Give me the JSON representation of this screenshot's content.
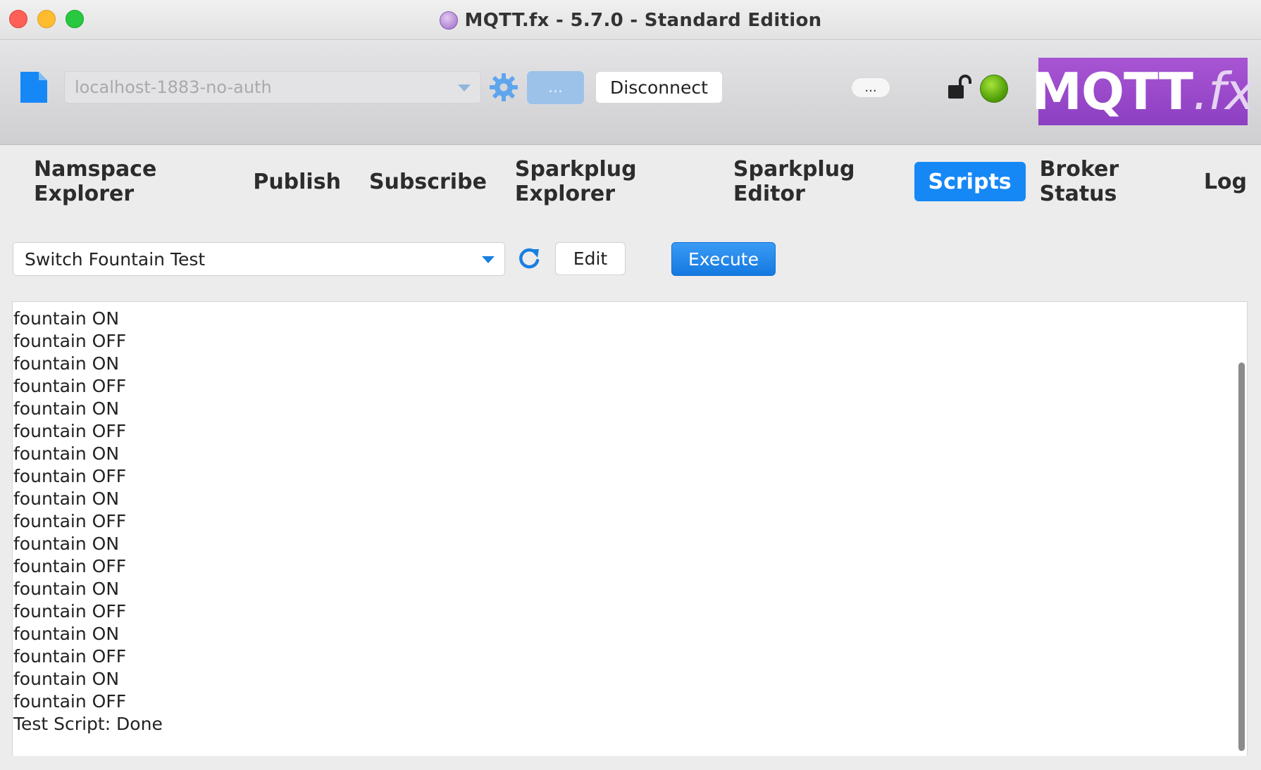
{
  "window": {
    "title": "MQTT.fx - 5.7.0 - Standard Edition"
  },
  "toolbar": {
    "connection_profile": "localhost-1883-no-auth",
    "options_label": "...",
    "disconnect_label": "Disconnect",
    "more_label": "...",
    "status_color": "#5aa80e"
  },
  "logo": {
    "text_main": "MQTT",
    "text_dot": ".",
    "text_fx": "fx",
    "background": "#9b4fcf"
  },
  "tabs": [
    {
      "label": "Namspace Explorer",
      "active": false
    },
    {
      "label": "Publish",
      "active": false
    },
    {
      "label": "Subscribe",
      "active": false
    },
    {
      "label": "Sparkplug Explorer",
      "active": false
    },
    {
      "label": "Sparkplug Editor",
      "active": false
    },
    {
      "label": "Scripts",
      "active": true
    },
    {
      "label": "Broker Status",
      "active": false
    },
    {
      "label": "Log",
      "active": false
    }
  ],
  "scripts": {
    "selected_script": "Switch Fountain Test",
    "edit_label": "Edit",
    "execute_label": "Execute",
    "accent_color": "#1688f5"
  },
  "output": {
    "lines": [
      "fountain ON",
      "fountain OFF",
      "fountain ON",
      "fountain OFF",
      "fountain ON",
      "fountain OFF",
      "fountain ON",
      "fountain OFF",
      "fountain ON",
      "fountain OFF",
      "fountain ON",
      "fountain OFF",
      "fountain ON",
      "fountain OFF",
      "fountain ON",
      "fountain OFF",
      "fountain ON",
      "fountain OFF",
      "Test Script: Done"
    ]
  },
  "icons": {
    "file": "file-icon",
    "gear": "gear-icon",
    "lock": "unlocked-padlock-icon",
    "refresh": "refresh-icon",
    "caret": "chevron-down-icon"
  }
}
